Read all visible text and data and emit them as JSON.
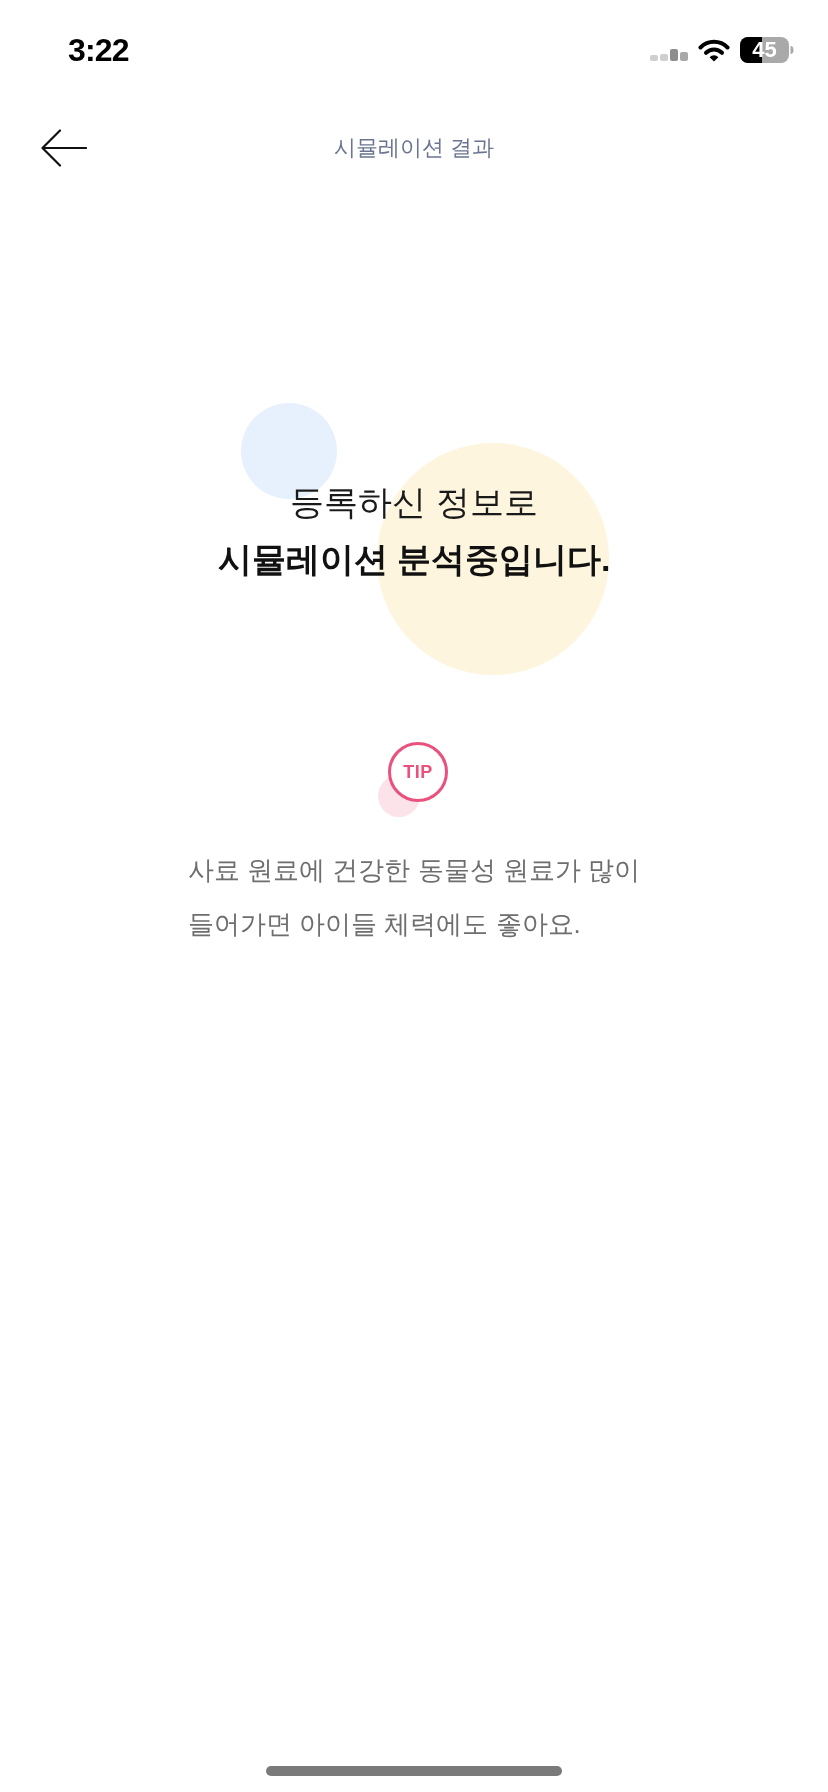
{
  "status_bar": {
    "time": "3:22",
    "battery": "45"
  },
  "header": {
    "title": "시뮬레이션 결과"
  },
  "message": {
    "line_1": "등록하신 정보로",
    "line_2": "시뮬레이션 분석중입니다."
  },
  "tip": {
    "badge": "TIP",
    "lines": [
      "사료 원료에 건강한 동물성 원료가 많이",
      "들어가면 아이들 체력에도 좋아요."
    ]
  }
}
